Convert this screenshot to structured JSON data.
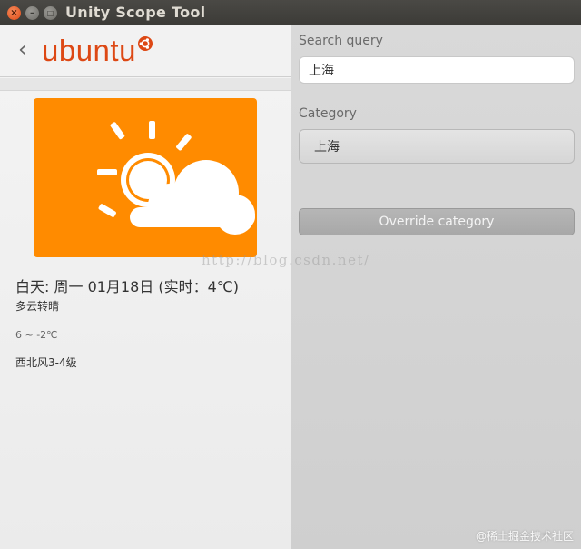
{
  "window": {
    "title": "Unity Scope Tool",
    "close_glyph": "×",
    "minimize_glyph": "–",
    "maximize_glyph": "□"
  },
  "preview": {
    "back_glyph": "‹",
    "logo_text": "ubuntu",
    "weather_icon": "partly-cloudy-icon",
    "image_bg": "#ff8b00",
    "day_line": "白天: 周一 01月18日 (实时：4℃)",
    "condition": "多云转晴",
    "temperature": "6 ~ -2℃",
    "wind": "西北风3-4级"
  },
  "controls": {
    "search_label": "Search query",
    "search_value": "上海",
    "category_label": "Category",
    "category_value": "上海",
    "override_label": "Override category"
  },
  "watermarks": {
    "url": "http://blog.csdn.net/",
    "corner": "@稀土掘金技术社区"
  },
  "colors": {
    "brand": "#dd4814",
    "weather_bg": "#ff8b00",
    "titlebar": "#3c3b37"
  }
}
